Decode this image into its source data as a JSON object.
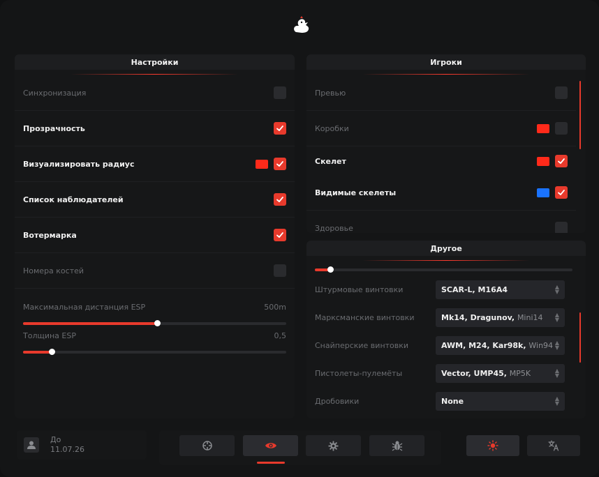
{
  "settings_panel": {
    "title": "Настройки",
    "rows": [
      {
        "label": "Синхронизация",
        "checked": false
      },
      {
        "label": "Прозрачность",
        "checked": true
      },
      {
        "label": "Визуализировать радиус",
        "checked": true,
        "color": "#ff2a1a"
      },
      {
        "label": "Список наблюдателей",
        "checked": true
      },
      {
        "label": "Вотермарка",
        "checked": true
      },
      {
        "label": "Номера костей",
        "checked": false
      }
    ],
    "sliders": [
      {
        "label": "Максимальная дистанция ESP",
        "value_text": "500m",
        "fraction": 0.51
      },
      {
        "label": "Толщина ESP",
        "value_text": "0,5",
        "fraction": 0.11
      }
    ]
  },
  "players_panel": {
    "title": "Игроки",
    "rows": [
      {
        "label": "Превью",
        "checked": false
      },
      {
        "label": "Коробки",
        "checked": false,
        "color": "#ff2a1a"
      },
      {
        "label": "Скелет",
        "checked": true,
        "color": "#ff2a1a"
      },
      {
        "label": "Видимые скелеты",
        "checked": true,
        "color": "#1a73ff"
      },
      {
        "label": "Здоровье",
        "checked": false
      }
    ]
  },
  "other_panel": {
    "title": "Другое",
    "top_slider_fraction": 0.06,
    "selects": [
      {
        "label": "Штурмовые винтовки",
        "value": "SCAR-L, M16A4",
        "muted": ""
      },
      {
        "label": "Марксманские винтовки",
        "value": "Mk14, Dragunov, ",
        "muted": "Mini14"
      },
      {
        "label": "Снайперские винтовки",
        "value": "AWM, M24, Kar98k, ",
        "muted": "Win94"
      },
      {
        "label": "Пистолеты-пулемёты",
        "value": "Vector, UMP45, ",
        "muted": "MP5K"
      },
      {
        "label": "Дробовики",
        "value": "None",
        "muted": ""
      }
    ]
  },
  "footer": {
    "user_line1": "До",
    "user_line2": "11.07.26"
  },
  "colors": {
    "accent": "#e83a2c"
  },
  "icons": {
    "logo": "duck-icon",
    "nav": [
      "crosshair-icon",
      "eye-icon",
      "gear-icon",
      "bug-icon"
    ],
    "side": [
      "sun-icon",
      "translate-icon"
    ]
  }
}
